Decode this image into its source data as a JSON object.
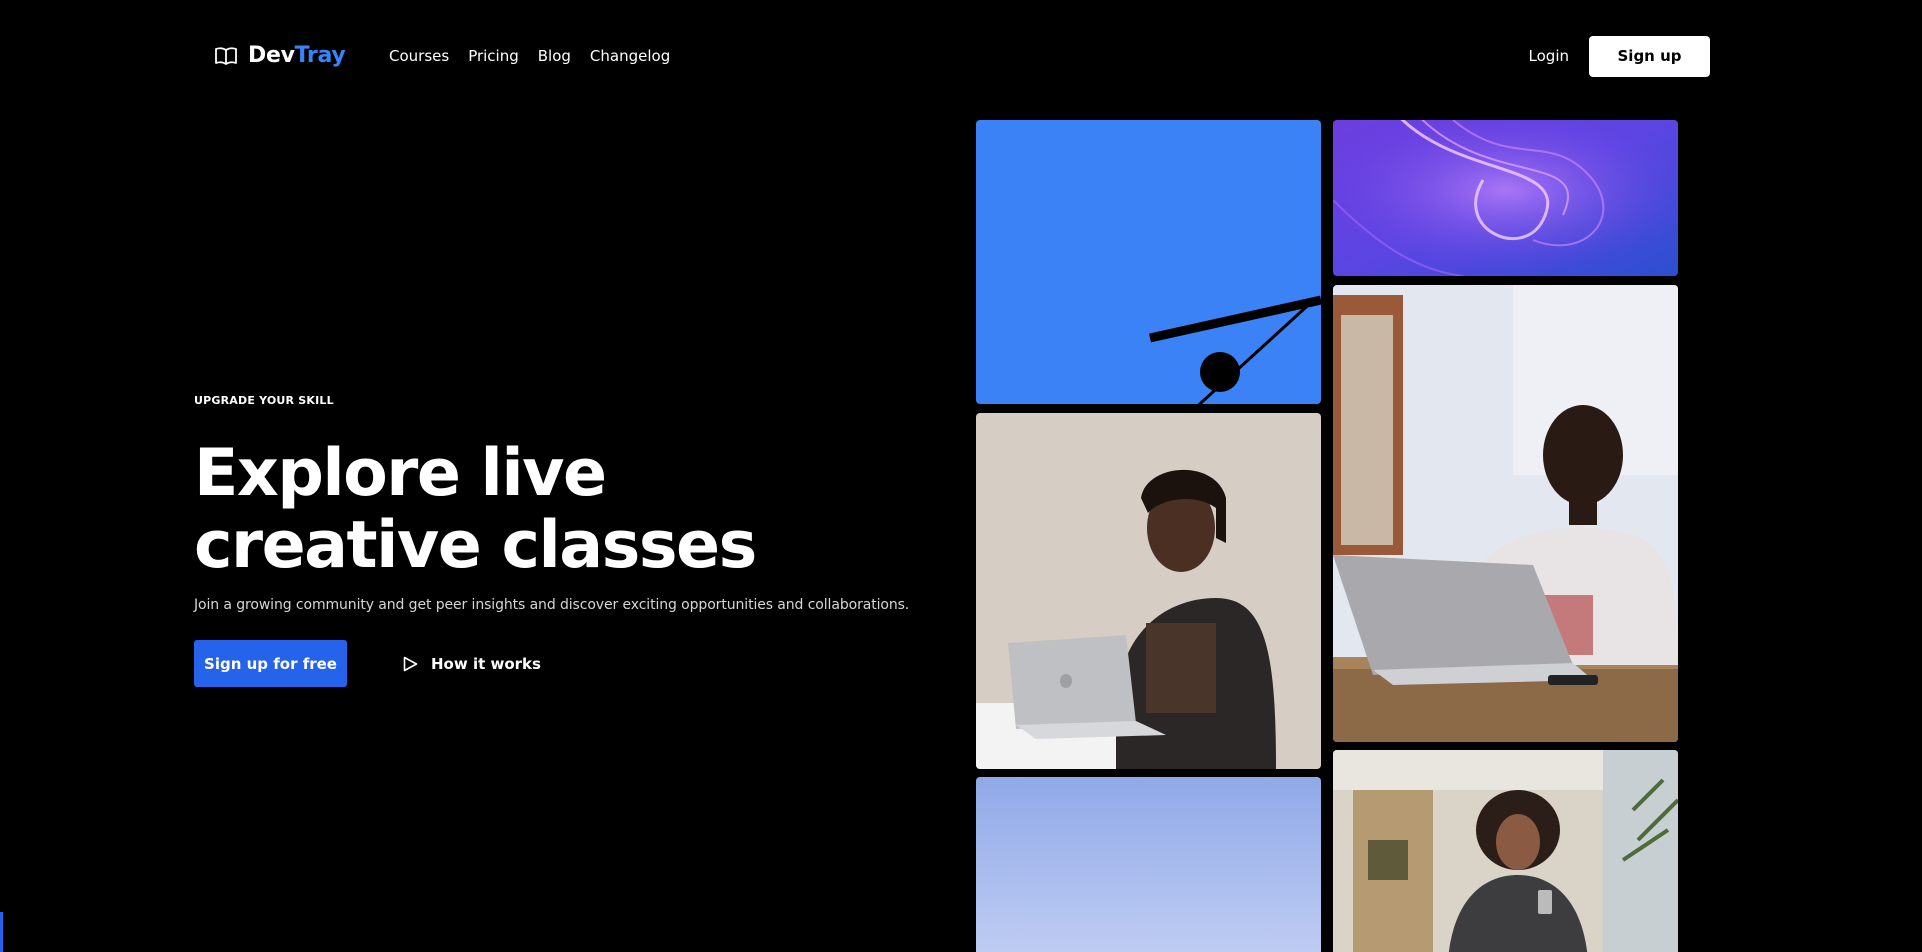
{
  "brand": {
    "name_part1": "Dev",
    "name_part2": "Tray",
    "icon": "open-book-icon",
    "accent_color": "#3b82f6"
  },
  "nav": {
    "links": [
      {
        "label": "Courses"
      },
      {
        "label": "Pricing"
      },
      {
        "label": "Blog"
      },
      {
        "label": "Changelog"
      }
    ],
    "login_label": "Login",
    "signup_label": "Sign up"
  },
  "hero": {
    "eyebrow": "UPGRADE YOUR SKILL",
    "headline_line1": "Explore live",
    "headline_line2": "creative classes",
    "subtitle": "Join a growing community and get peer insights and discover exciting opportunities and collaborations.",
    "primary_cta": "Sign up for free",
    "secondary_cta": "How it works",
    "secondary_icon": "play-icon"
  },
  "gallery": {
    "tiles": [
      {
        "name": "blue-abstract-image"
      },
      {
        "name": "purple-light-image"
      },
      {
        "name": "student-laptop-image"
      },
      {
        "name": "man-laptop-image"
      },
      {
        "name": "sky-image"
      },
      {
        "name": "woman-phone-image"
      }
    ]
  },
  "colors": {
    "background": "#000000",
    "primary_button": "#2563eb",
    "blue_tile": "#3b82f6"
  }
}
